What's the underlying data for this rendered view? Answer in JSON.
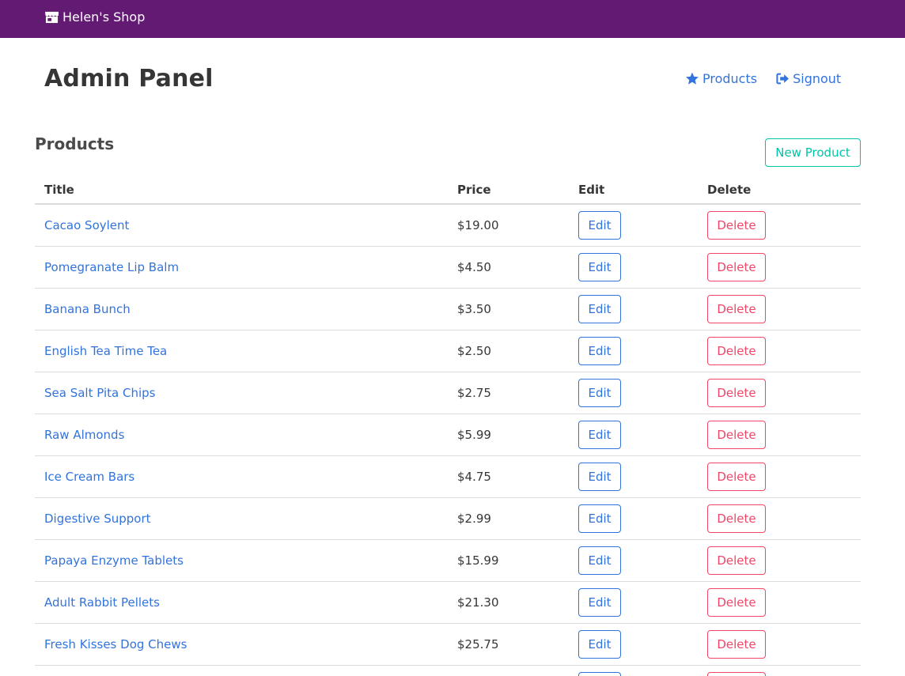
{
  "navbar": {
    "brand_label": "Helen's Shop",
    "brand_icon": "store-icon",
    "background": "#621a73"
  },
  "header": {
    "title": "Admin Panel",
    "links": [
      {
        "label": "Products",
        "icon": "star-icon"
      },
      {
        "label": "Signout",
        "icon": "sign-out-icon"
      }
    ]
  },
  "products": {
    "section_title": "Products",
    "new_button_label": "New Product",
    "columns": [
      "Title",
      "Price",
      "Edit",
      "Delete"
    ],
    "edit_label": "Edit",
    "delete_label": "Delete",
    "rows": [
      {
        "title": "Cacao Soylent",
        "price": "$19.00"
      },
      {
        "title": "Pomegranate Lip Balm",
        "price": "$4.50"
      },
      {
        "title": "Banana Bunch",
        "price": "$3.50"
      },
      {
        "title": "English Tea Time Tea",
        "price": "$2.50"
      },
      {
        "title": "Sea Salt Pita Chips",
        "price": "$2.75"
      },
      {
        "title": "Raw Almonds",
        "price": "$5.99"
      },
      {
        "title": "Ice Cream Bars",
        "price": "$4.75"
      },
      {
        "title": "Digestive Support",
        "price": "$2.99"
      },
      {
        "title": "Papaya Enzyme Tablets",
        "price": "$15.99"
      },
      {
        "title": "Adult Rabbit Pellets",
        "price": "$21.30"
      },
      {
        "title": "Fresh Kisses Dog Chews",
        "price": "$25.75"
      },
      {
        "title": "",
        "price": ""
      }
    ]
  },
  "colors": {
    "link": "#3273dc",
    "success": "#00c4a7",
    "danger": "#f14668"
  }
}
